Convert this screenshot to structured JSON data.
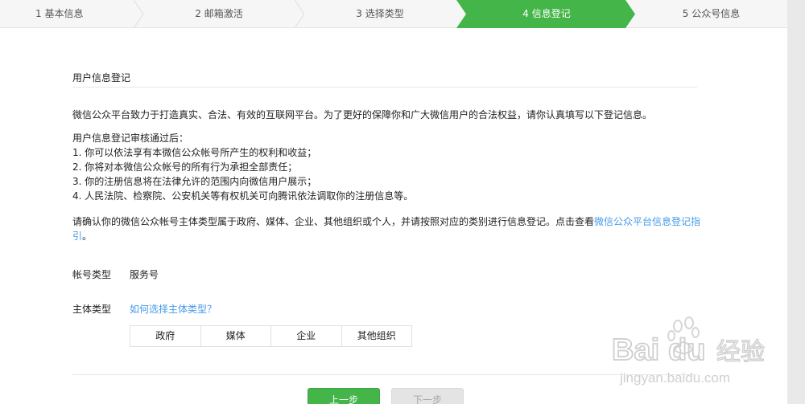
{
  "steps": [
    {
      "label": "1 基本信息",
      "state": "done"
    },
    {
      "label": "2 邮箱激活",
      "state": "done"
    },
    {
      "label": "3 选择类型",
      "state": "done"
    },
    {
      "label": "4 信息登记",
      "state": "active"
    },
    {
      "label": "5 公众号信息",
      "state": "todo"
    }
  ],
  "colors": {
    "accent": "#44b549",
    "link": "#459ae9"
  },
  "section": {
    "title": "用户信息登记"
  },
  "intro": "微信公众平台致力于打造真实、合法、有效的互联网平台。为了更好的保障你和广大微信用户的合法权益，请你认真填写以下登记信息。",
  "after_review": {
    "heading": "用户信息登记审核通过后：",
    "items": [
      "1. 你可以依法享有本微信公众帐号所产生的权利和收益；",
      "2. 你将对本微信公众帐号的所有行为承担全部责任；",
      "3. 你的注册信息将在法律允许的范围内向微信用户展示；",
      "4. 人民法院、检察院、公安机关等有权机关可向腾讯依法调取你的注册信息等。"
    ]
  },
  "confirm": {
    "text": "请确认你的微信公众帐号主体类型属于政府、媒体、企业、其他组织或个人，并请按照对应的类别进行信息登记。点击查看",
    "link_line1": "微信公众平台信息登记指",
    "link_line2": "引",
    "tail": "。"
  },
  "account_type": {
    "label": "帐号类型",
    "value": "服务号"
  },
  "subject_type": {
    "label": "主体类型",
    "help_link": "如何选择主体类型？",
    "options": [
      "政府",
      "媒体",
      "企业",
      "其他组织"
    ]
  },
  "buttons": {
    "prev": "上一步",
    "next": "下一步"
  },
  "watermark": {
    "brand": "Bai",
    "brand2": "du",
    "suffix": "经验",
    "url": "jingyan.baidu.com"
  }
}
